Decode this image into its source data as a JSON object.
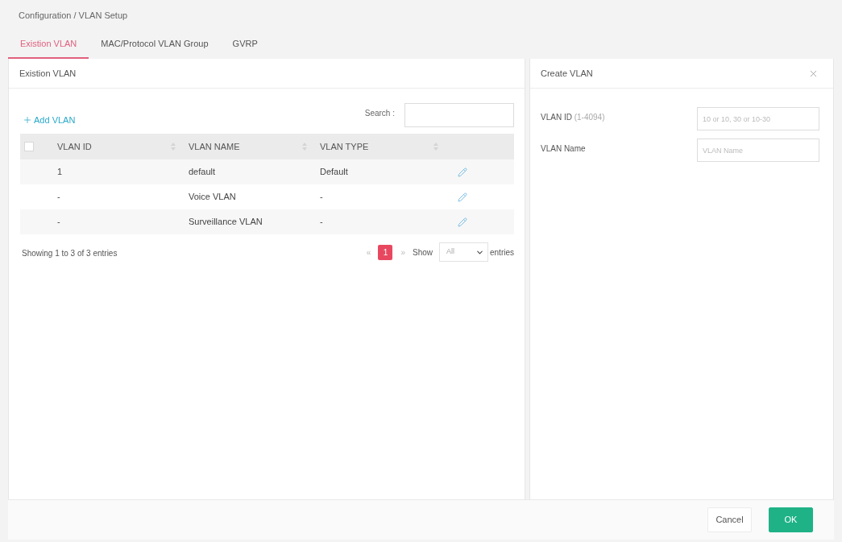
{
  "breadcrumb": "Configuration / VLAN Setup",
  "tabs": [
    {
      "label": "Existion VLAN",
      "selected": true
    },
    {
      "label": "MAC/Protocol VLAN Group",
      "selected": false
    },
    {
      "label": "GVRP",
      "selected": false
    }
  ],
  "vlan_panel": {
    "title": "Existion VLAN",
    "add_button": "Add VLAN",
    "search": {
      "label": "Search :"
    },
    "table": {
      "select_all": {
        "checked": false
      },
      "columns": [
        "VLAN ID",
        "VLAN NAME",
        "VLAN TYPE"
      ],
      "rows": [
        {
          "vlan_id": "1",
          "vlan_name": "default",
          "vlan_type": "Default"
        },
        {
          "vlan_id": "-",
          "vlan_name": "Voice VLAN",
          "vlan_type": "-"
        },
        {
          "vlan_id": "-",
          "vlan_name": "Surveillance VLAN",
          "vlan_type": "-"
        }
      ]
    },
    "pagination": {
      "summary": "Showing 1 to 3 of 3 entries",
      "previous": "«",
      "pages": [
        {
          "label": "1",
          "selected": true
        }
      ],
      "next": "»",
      "show_label": "Show",
      "page_size": "All",
      "entries_label": "entries"
    }
  },
  "create_panel": {
    "title": "Create VLAN",
    "fields": [
      {
        "label": "VLAN ID",
        "hint": "(1-4094)",
        "placeholder": "10 or 10, 30 or 10-30"
      },
      {
        "label": "VLAN Name",
        "placeholder": "VLAN Name"
      }
    ]
  },
  "footer_buttons": [
    {
      "label": "Cancel",
      "kind": "secondary"
    },
    {
      "label": "OK",
      "kind": "primary"
    }
  ]
}
